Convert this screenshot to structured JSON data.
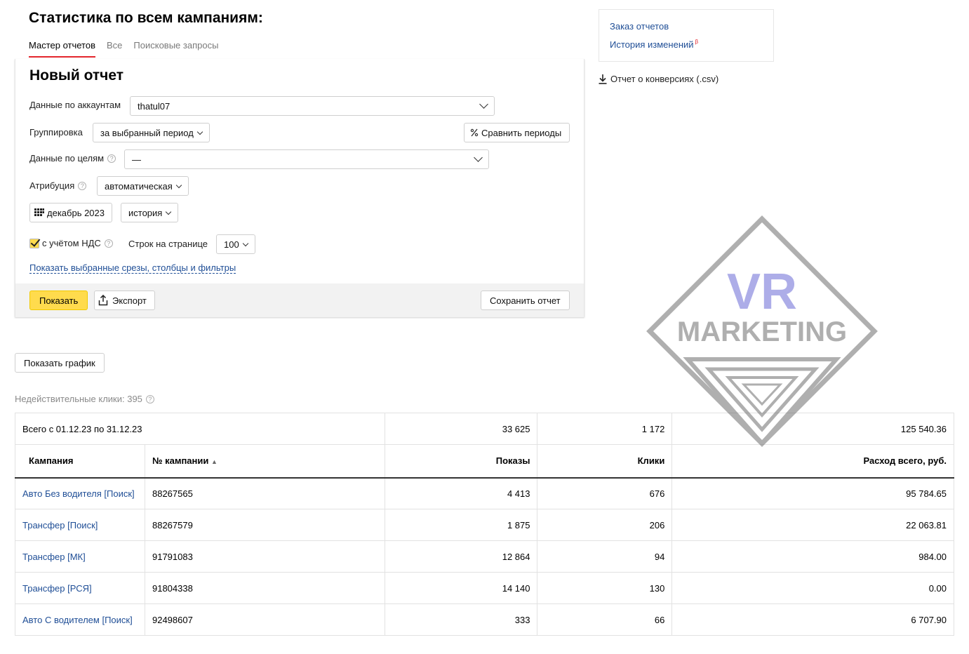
{
  "page": {
    "title": "Статистика по всем кампаниям:",
    "tabs": [
      {
        "label": "Мастер отчетов",
        "active": true
      },
      {
        "label": "Все",
        "active": false
      },
      {
        "label": "Поисковые запросы",
        "active": false
      }
    ]
  },
  "form": {
    "title": "Новый отчет",
    "accounts_label": "Данные по аккаунтам",
    "accounts_value": "thatul07",
    "grouping_label": "Группировка",
    "grouping_value": "за выбранный период",
    "compare_label": "Сравнить периоды",
    "goals_label": "Данные по целям",
    "goals_value": "—",
    "attribution_label": "Атрибуция",
    "attribution_value": "автоматическая",
    "date_value": "декабрь 2023",
    "history_value": "история",
    "vat_label": "с учётом НДС",
    "vat_checked": true,
    "rows_label": "Строк на странице",
    "rows_value": "100",
    "show_slices_link": "Показать выбранные срезы, столбцы и фильтры",
    "help_glyph": "?",
    "show_button": "Показать",
    "export_button": "Экспорт",
    "save_button": "Сохранить отчет"
  },
  "sidebar": {
    "order_reports": "Заказ отчетов",
    "change_history": "История изменений",
    "beta_mark": "β",
    "conversions_report": "Отчет о конверсиях (.csv)"
  },
  "chart_toggle": "Показать график",
  "invalid_clicks": "Недействительные клики: 395",
  "watermark": {
    "line1": "VR",
    "line2": "MARKETING"
  },
  "table": {
    "total": {
      "label": "Всего с 01.12.23 по 31.12.23",
      "impressions": "33 625",
      "clicks": "1 172",
      "spend": "125 540.36"
    },
    "headers": {
      "campaign": "Кампания",
      "campaign_id": "№ кампании",
      "sort_indicator": "▲",
      "impressions": "Показы",
      "clicks": "Клики",
      "spend": "Расход всего, руб."
    },
    "rows": [
      {
        "campaign": "Авто Без водителя [Поиск]",
        "id": "88267565",
        "impressions": "4 413",
        "clicks": "676",
        "spend": "95 784.65"
      },
      {
        "campaign": "Трансфер [Поиск]",
        "id": "88267579",
        "impressions": "1 875",
        "clicks": "206",
        "spend": "22 063.81"
      },
      {
        "campaign": "Трансфер [МК]",
        "id": "91791083",
        "impressions": "12 864",
        "clicks": "94",
        "spend": "984.00"
      },
      {
        "campaign": "Трансфер [РСЯ]",
        "id": "91804338",
        "impressions": "14 140",
        "clicks": "130",
        "spend": "0.00"
      },
      {
        "campaign": "Авто С водителем [Поиск]",
        "id": "92498607",
        "impressions": "333",
        "clicks": "66",
        "spend": "6 707.90"
      }
    ]
  },
  "colors": {
    "accent_yellow": "#ffdb4d",
    "link_blue": "#1f4e96",
    "tab_red": "#e3262d"
  }
}
